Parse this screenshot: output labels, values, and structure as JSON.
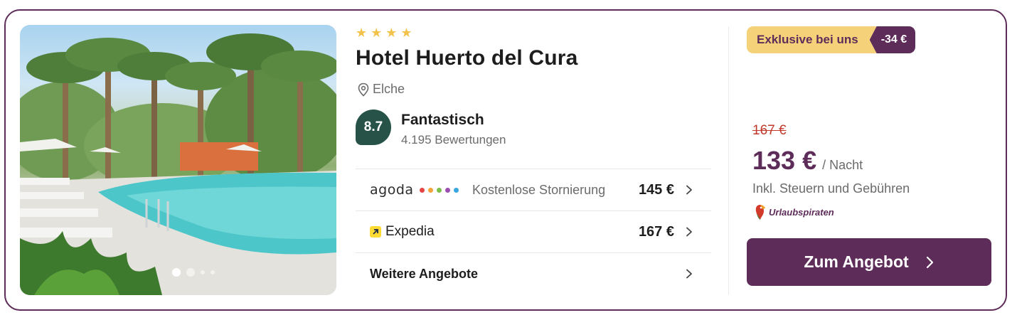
{
  "hotel": {
    "stars": 4,
    "name": "Hotel Huerto del Cura",
    "location": "Elche",
    "score": "8.7",
    "rating_word": "Fantastisch",
    "review_count": "4.195 Bewertungen"
  },
  "gallery": {
    "dot_count": 4,
    "active_index": 0
  },
  "offers": [
    {
      "partner": "agoda",
      "note": "Kostenlose Stornierung",
      "price": "145 €"
    },
    {
      "partner": "Expedia",
      "note": "",
      "price": "167 €"
    },
    {
      "partner": "Weitere Angebote",
      "note": "",
      "price": ""
    }
  ],
  "agoda_dot_colors": [
    "#e64545",
    "#f2a33a",
    "#7cc04b",
    "#9b4fb1",
    "#3aa6de"
  ],
  "deal": {
    "exclusive_label": "Exklusive bei uns",
    "discount": "-34 €"
  },
  "pricing": {
    "old_price": "167 €",
    "new_price": "133 €",
    "per_night": "/ Nacht",
    "tax_note": "Inkl. Steuern und Gebühren",
    "provider": "Urlaubspiraten"
  },
  "cta": {
    "label": "Zum Angebot"
  },
  "colors": {
    "brand": "#5e2c59",
    "score_badge": "#265248",
    "deal_yellow": "#f5d27a",
    "star": "#f3c24a",
    "strike_red": "#c0392b"
  }
}
